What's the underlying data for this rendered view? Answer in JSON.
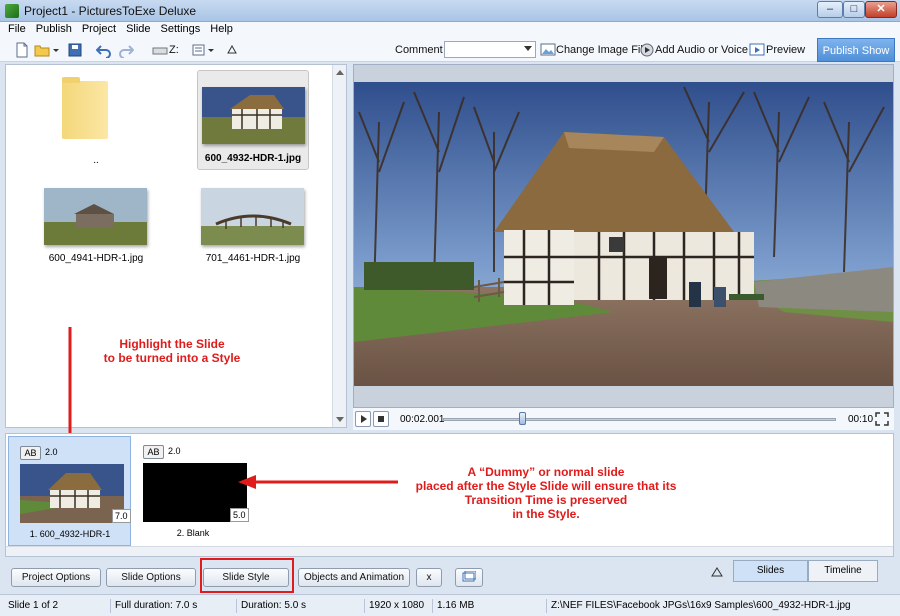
{
  "window": {
    "title": "Project1 - PicturesToExe Deluxe",
    "buttons": [
      "–",
      "□",
      "✕"
    ]
  },
  "menu": [
    "File",
    "Publish",
    "Project",
    "Slide",
    "Settings",
    "Help"
  ],
  "toolbar": {
    "drive_label": "Z:",
    "comment_label": "Comment",
    "comment_value": "",
    "change_image_label": "Change Image File",
    "add_audio_label": "Add Audio or Voice",
    "preview_label": "Preview",
    "publish_label": "Publish Show"
  },
  "file_browser": {
    "items": [
      {
        "name": "..",
        "kind": "folder"
      },
      {
        "name": "600_4932-HDR-1.jpg",
        "kind": "image",
        "selected": true
      },
      {
        "name": "600_4941-HDR-1.jpg",
        "kind": "image"
      },
      {
        "name": "701_4461-HDR-1.jpg",
        "kind": "image"
      }
    ]
  },
  "player": {
    "current_time": "00:02.001",
    "total_time": "00:10",
    "progress": 0.2
  },
  "slides": [
    {
      "ab": "AB",
      "transition": "2.0",
      "duration": "7.0",
      "caption": "1. 600_4932-HDR-1",
      "selected": true
    },
    {
      "ab": "AB",
      "transition": "2.0",
      "duration": "5.0",
      "caption": "2. Blank",
      "selected": false
    }
  ],
  "annotations": {
    "highlight_line1": "Highlight the Slide",
    "highlight_line2": "to be turned into a Style",
    "dummy_line1": "A “Dummy” or normal slide",
    "dummy_line2": "placed after the Style Slide will ensure that its",
    "dummy_line3": "Transition Time is preserved",
    "dummy_line4": "in the Style."
  },
  "bottom_buttons": {
    "project_options": "Project Options",
    "slide_options": "Slide Options",
    "slide_style": "Slide Style",
    "objects_animation": "Objects and Animation",
    "x": "x"
  },
  "tabs": {
    "slides": "Slides",
    "timeline": "Timeline",
    "active": "Slides"
  },
  "status": {
    "slide": "Slide 1 of 2",
    "full_duration": "Full duration: 7.0 s",
    "duration": "Duration: 5.0 s",
    "resolution": "1920 x 1080",
    "size": "1.16 MB",
    "path": "Z:\\NEF FILES\\Facebook JPGs\\16x9 Samples\\600_4932-HDR-1.jpg"
  },
  "colors": {
    "annotation": "#e01b1b",
    "accent": "#4f8fd8"
  }
}
